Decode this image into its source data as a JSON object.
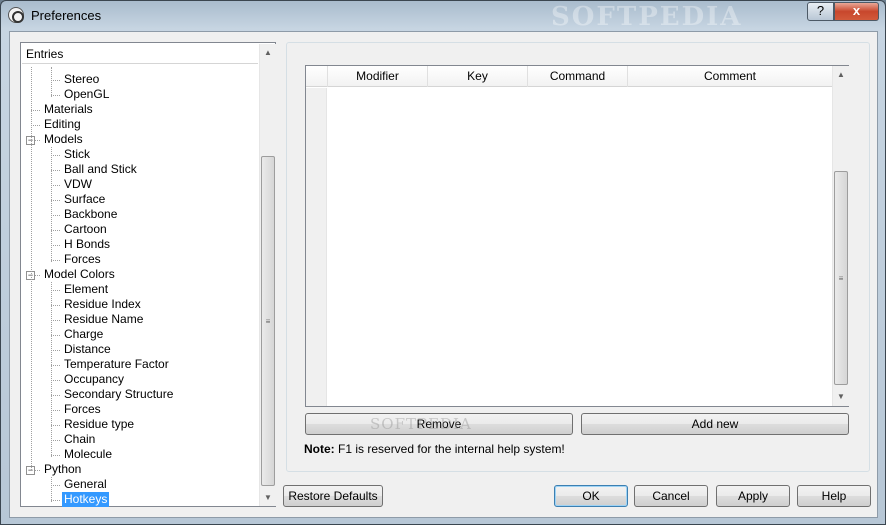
{
  "window": {
    "title": "Preferences",
    "watermark": "SOFTPEDIA",
    "help_glyph": "?",
    "close_glyph": "x"
  },
  "tree": {
    "header": "Entries",
    "items": [
      {
        "label": "Stereo",
        "level": 2,
        "expander": null
      },
      {
        "label": "OpenGL",
        "level": 2,
        "expander": null
      },
      {
        "label": "Materials",
        "level": 1,
        "expander": null
      },
      {
        "label": "Editing",
        "level": 1,
        "expander": null
      },
      {
        "label": "Models",
        "level": 1,
        "expander": "minus"
      },
      {
        "label": "Stick",
        "level": 2,
        "expander": null
      },
      {
        "label": "Ball and Stick",
        "level": 2,
        "expander": null
      },
      {
        "label": "VDW",
        "level": 2,
        "expander": null
      },
      {
        "label": "Surface",
        "level": 2,
        "expander": null
      },
      {
        "label": "Backbone",
        "level": 2,
        "expander": null
      },
      {
        "label": "Cartoon",
        "level": 2,
        "expander": null
      },
      {
        "label": "H Bonds",
        "level": 2,
        "expander": null
      },
      {
        "label": "Forces",
        "level": 2,
        "expander": null
      },
      {
        "label": "Model Colors",
        "level": 1,
        "expander": "minus"
      },
      {
        "label": "Element",
        "level": 2,
        "expander": null
      },
      {
        "label": "Residue Index",
        "level": 2,
        "expander": null
      },
      {
        "label": "Residue Name",
        "level": 2,
        "expander": null
      },
      {
        "label": "Charge",
        "level": 2,
        "expander": null
      },
      {
        "label": "Distance",
        "level": 2,
        "expander": null
      },
      {
        "label": "Temperature Factor",
        "level": 2,
        "expander": null
      },
      {
        "label": "Occupancy",
        "level": 2,
        "expander": null
      },
      {
        "label": "Secondary Structure",
        "level": 2,
        "expander": null
      },
      {
        "label": "Forces",
        "level": 2,
        "expander": null
      },
      {
        "label": "Residue type",
        "level": 2,
        "expander": null
      },
      {
        "label": "Chain",
        "level": 2,
        "expander": null
      },
      {
        "label": "Molecule",
        "level": 2,
        "expander": null
      },
      {
        "label": "Python",
        "level": 1,
        "expander": "minus"
      },
      {
        "label": "General",
        "level": 2,
        "expander": null
      },
      {
        "label": "Hotkeys",
        "level": 2,
        "expander": null,
        "selected": true
      }
    ]
  },
  "hotkeys_table": {
    "columns": [
      "Modifier",
      "Key",
      "Command",
      "Comment"
    ],
    "rows": []
  },
  "buttons": {
    "remove": "Remove",
    "add_new": "Add new",
    "restore_defaults": "Restore Defaults",
    "ok": "OK",
    "cancel": "Cancel",
    "apply": "Apply",
    "help": "Help"
  },
  "note": {
    "prefix": "Note:",
    "text": " F1 is reserved for the internal help system!"
  },
  "scrollbar": {
    "up_glyph": "▲",
    "down_glyph": "▼",
    "grip_glyph": "≡"
  }
}
